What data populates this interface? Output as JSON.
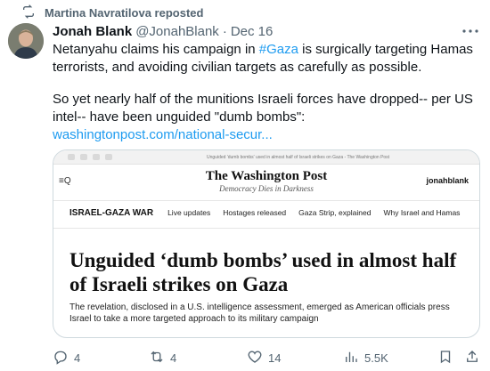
{
  "repost": {
    "text": "Martina Navratilova reposted"
  },
  "tweet": {
    "author_name": "Jonah Blank",
    "author_handle": "@JonahBlank",
    "separator": "·",
    "date": "Dec 16",
    "text_line1_before": "Netanyahu claims his campaign in ",
    "hashtag": "#Gaza",
    "text_line1_after": " is surgically targeting Hamas terrorists, and avoiding civilian targets as carefully as possible.",
    "text_para2": "So yet nearly half of the munitions Israeli forces have dropped-- per US intel-- have been unguided \"dumb bombs\":",
    "link": "washingtonpost.com/national-secur..."
  },
  "card": {
    "browser_title": "Unguided 'dumb bombs' used in almost half of Israeli strikes on Gaza - The Washington Post",
    "logo": "The Washington Post",
    "tagline": "Democracy Dies in Darkness",
    "menu": "≡Q",
    "user": "jonahblank",
    "section": "ISRAEL-GAZA WAR",
    "nav": [
      "Live updates",
      "Hostages released",
      "Gaza Strip, explained",
      "Why Israel and Hamas"
    ],
    "headline": "Unguided ‘dumb bombs’ used in almost half of Israeli strikes on Gaza",
    "dek": "The revelation, disclosed in a U.S. intelligence assessment, emerged as American officials press Israel to take a more targeted approach to its military campaign"
  },
  "actions": {
    "replies": "4",
    "reposts": "4",
    "likes": "14",
    "views": "5.5K"
  },
  "colors": {
    "accent": "#1d9bf0",
    "secondary_text": "#536471",
    "border": "#cfd9de"
  }
}
